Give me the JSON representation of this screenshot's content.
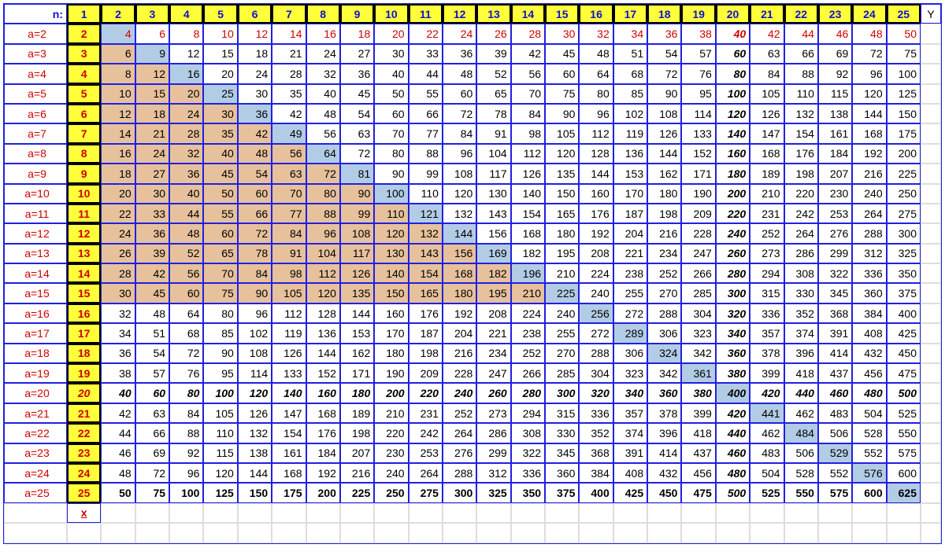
{
  "nLabel": "n:",
  "yLabel": "Y",
  "xLabel": "x",
  "cols": 25,
  "rows": [
    {
      "a": 2
    },
    {
      "a": 3
    },
    {
      "a": 4
    },
    {
      "a": 5
    },
    {
      "a": 6
    },
    {
      "a": 7
    },
    {
      "a": 8
    },
    {
      "a": 9
    },
    {
      "a": 10
    },
    {
      "a": 11
    },
    {
      "a": 12
    },
    {
      "a": 13
    },
    {
      "a": 14
    },
    {
      "a": 15
    },
    {
      "a": 16
    },
    {
      "a": 17
    },
    {
      "a": 18
    },
    {
      "a": 19
    },
    {
      "a": 20
    },
    {
      "a": 21
    },
    {
      "a": 22
    },
    {
      "a": 23
    },
    {
      "a": 24
    },
    {
      "a": 25
    }
  ],
  "shadedMaxRow": 15,
  "boldItalicRow": 20,
  "boldItalicCol": 20,
  "boldRow": 25,
  "chart_notes": "Multiplication table cells = a * n for a=2..25 and n=1..25. Column 1 highlighted yellow. Diagonal n=a (perfect squares) highlighted blue. Cells where a<=15 and n<=a shaded tan. Row a=20 and column n=20 rendered bold-italic. Row a=25 rendered bold. First data row (a=2) uses red text."
}
